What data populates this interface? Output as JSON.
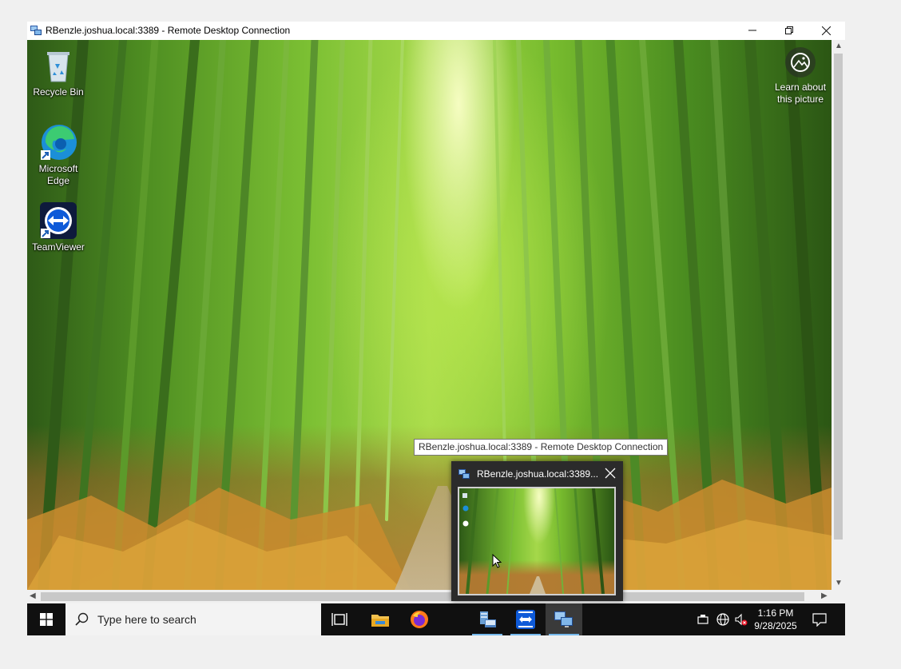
{
  "window": {
    "title": "RBenzle.joshua.local:3389 - Remote Desktop Connection",
    "minimize_icon": "minimize-icon",
    "restore_icon": "restore-icon",
    "close_icon": "close-icon"
  },
  "desktop": {
    "icons": [
      {
        "label": "Recycle Bin",
        "icon": "recycle-bin-icon"
      },
      {
        "label": "Microsoft Edge",
        "icon": "edge-icon"
      },
      {
        "label": "TeamViewer",
        "icon": "teamviewer-icon"
      }
    ],
    "learn_label": "Learn about this picture"
  },
  "tooltip": "RBenzle.joshua.local:3389 - Remote Desktop Connection",
  "preview": {
    "title": "RBenzle.joshua.local:3389..."
  },
  "taskbar": {
    "search_placeholder": "Type here to search",
    "apps": [
      "task-view-icon",
      "file-explorer-icon",
      "firefox-icon",
      "server-manager-icon",
      "teamviewer-icon",
      "remote-desktop-icon"
    ],
    "clock_time": "1:16 PM",
    "clock_date": "9/28/2025"
  },
  "colors": {
    "taskbar": "#101010",
    "accent": "#76b9ed"
  }
}
